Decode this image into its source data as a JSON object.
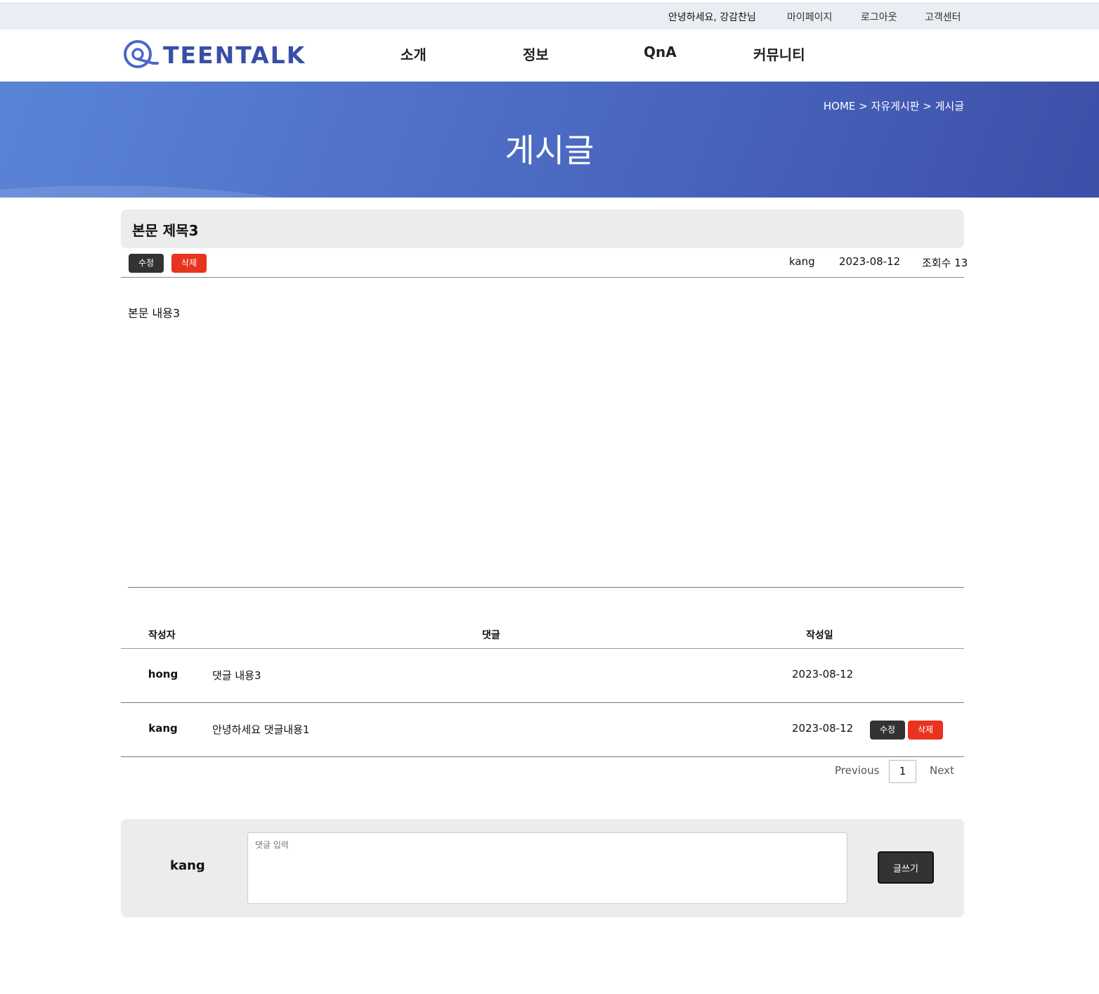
{
  "topbar": {
    "greeting": "안녕하세요, 강감찬님",
    "mypage": "마이페이지",
    "logout": "로그아웃",
    "support": "고객센터"
  },
  "header": {
    "logo_text": "TEENTALK",
    "nav": [
      "소개",
      "정보",
      "QnA",
      "커뮤니티"
    ]
  },
  "banner": {
    "breadcrumb": "HOME > 자유게시판 > 게시글",
    "title": "게시글"
  },
  "post": {
    "title": "본문 제목3",
    "edit_label": "수정",
    "delete_label": "삭제",
    "author": "kang",
    "date": "2023-08-12",
    "views": "조회수 13",
    "body": "본문 내용3"
  },
  "comments": {
    "headers": {
      "author": "작성자",
      "comment": "댓글",
      "date": "작성일"
    },
    "rows": [
      {
        "author": "hong",
        "text": "댓글 내용3",
        "date": "2023-08-12"
      },
      {
        "author": "kang",
        "text": "안녕하세요 댓글내용1",
        "date": "2023-08-12",
        "edit_label": "수정",
        "delete_label": "삭제"
      }
    ]
  },
  "pagination": {
    "prev": "Previous",
    "page": "1",
    "next": "Next"
  },
  "comment_form": {
    "user": "kang",
    "placeholder": "댓글 입력",
    "submit_label": "글쓰기"
  },
  "colors": {
    "brand": "#3a4ea6",
    "banner_start": "#5a84d6",
    "banner_end": "#3d4fa8",
    "danger": "#e8331f",
    "dark": "#333333"
  }
}
